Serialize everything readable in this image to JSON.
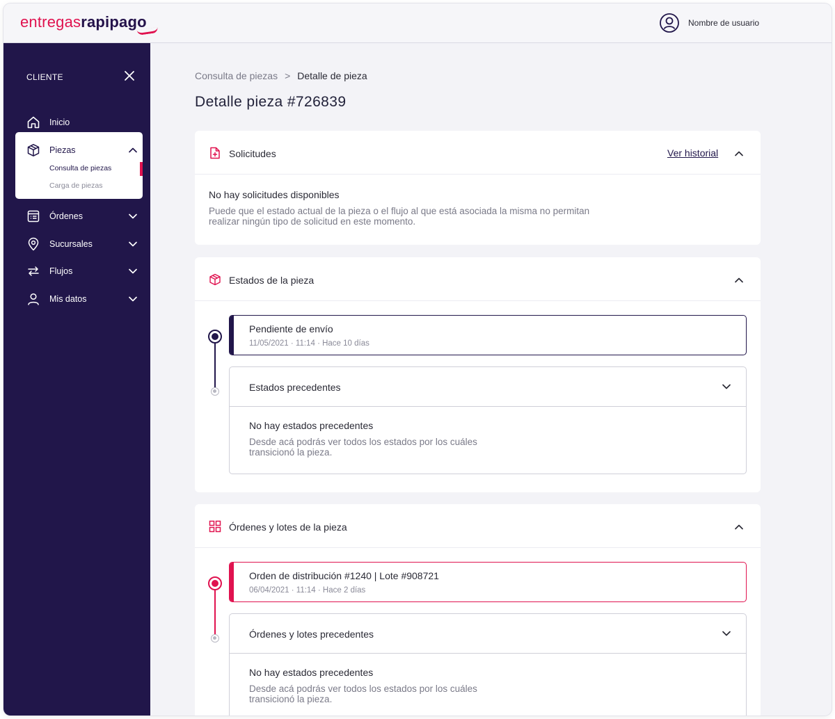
{
  "brand": {
    "part1": "entregas",
    "part2": "rapipago",
    "accent": "#e0124f",
    "primary": "#21164a"
  },
  "header": {
    "user_name": "Nombre de usuario",
    "user_icon": "user-circle-icon"
  },
  "sidebar": {
    "heading": "CLIENTE",
    "close_icon": "close-icon",
    "items": [
      {
        "label": "Inicio",
        "icon": "home-icon"
      },
      {
        "label": "Piezas",
        "icon": "box-icon",
        "expanded": true,
        "children": [
          {
            "label": "Consulta de piezas",
            "active": true
          },
          {
            "label": "Carga de piezas",
            "active": false
          }
        ]
      },
      {
        "label": "Órdenes",
        "icon": "orders-icon"
      },
      {
        "label": "Sucursales",
        "icon": "location-icon"
      },
      {
        "label": "Flujos",
        "icon": "flows-icon"
      },
      {
        "label": "Mis datos",
        "icon": "user-icon"
      }
    ]
  },
  "breadcrumb": {
    "parent": "Consulta de piezas",
    "separator": ">",
    "current": "Detalle de pieza"
  },
  "page": {
    "title": "Detalle pieza #726839"
  },
  "solicitudes": {
    "title": "Solicitudes",
    "link": "Ver historial",
    "empty_title": "No hay solicitudes disponibles",
    "empty_desc_line1": "Puede que el estado actual de la pieza o el flujo al que está asociada la misma no permitan",
    "empty_desc_line2": "realizar ningún tipo de solicitud en este momento."
  },
  "estados": {
    "title": "Estados de la pieza",
    "current": {
      "title": "Pendiente de envío",
      "date": "11/05/2021 · 11:14",
      "relative": "· Hace 10 días"
    },
    "previous": {
      "title": "Estados precedentes",
      "empty_title": "No hay estados precedentes",
      "empty_desc_line1": "Desde acá podrás ver todos los estados por los cuáles",
      "empty_desc_line2": "transicionó la pieza."
    }
  },
  "ordenes": {
    "title": "Órdenes y lotes de la pieza",
    "current": {
      "title": "Orden de distribución #1240 | Lote #908721",
      "date": "06/04/2021 · 11:14",
      "relative": "· Hace 2 días"
    },
    "previous": {
      "title": "Órdenes y lotes precedentes",
      "empty_title": "No hay estados precedentes",
      "empty_desc_line1": "Desde acá podrás ver todos los estados por los cuáles",
      "empty_desc_line2": "transicionó la pieza."
    }
  }
}
